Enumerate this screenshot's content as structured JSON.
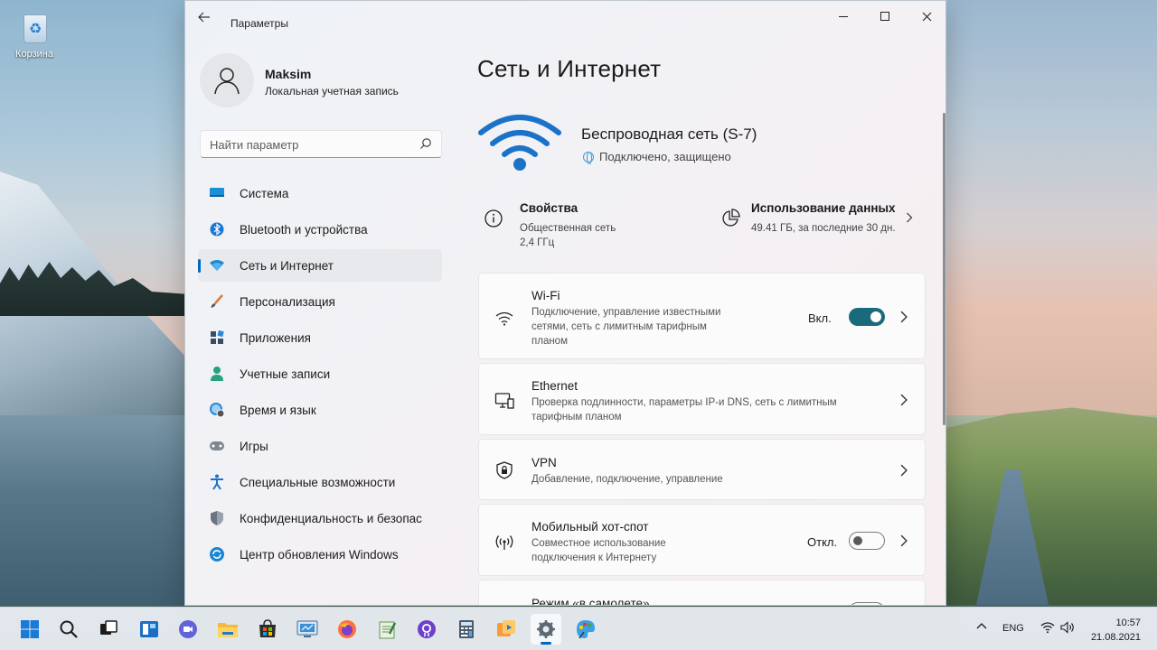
{
  "desktop": {
    "recycle_bin_label": "Корзина"
  },
  "window": {
    "title": "Параметры"
  },
  "profile": {
    "name": "Maksim",
    "account_type": "Локальная учетная запись"
  },
  "search": {
    "placeholder": "Найти параметр"
  },
  "sidebar": {
    "items": [
      {
        "label": "Система",
        "icon": "system-icon",
        "active": false
      },
      {
        "label": "Bluetooth и устройства",
        "icon": "bluetooth-icon",
        "active": false
      },
      {
        "label": "Сеть и Интернет",
        "icon": "network-icon",
        "active": true
      },
      {
        "label": "Персонализация",
        "icon": "brush-icon",
        "active": false
      },
      {
        "label": "Приложения",
        "icon": "apps-icon",
        "active": false
      },
      {
        "label": "Учетные записи",
        "icon": "accounts-icon",
        "active": false
      },
      {
        "label": "Время и язык",
        "icon": "time-language-icon",
        "active": false
      },
      {
        "label": "Игры",
        "icon": "gaming-icon",
        "active": false
      },
      {
        "label": "Специальные возможности",
        "icon": "accessibility-icon",
        "active": false
      },
      {
        "label": "Конфиденциальность и безопас",
        "icon": "shield-icon",
        "active": false
      },
      {
        "label": "Центр обновления Windows",
        "icon": "update-icon",
        "active": false
      }
    ]
  },
  "main": {
    "title": "Сеть и Интернет",
    "connection": {
      "name": "Беспроводная сеть (S-7)",
      "status": "Подключено, защищено"
    },
    "properties": {
      "title": "Свойства",
      "line1": "Общественная сеть",
      "line2": "2,4 ГГц"
    },
    "data_usage": {
      "title": "Использование данных",
      "subtitle": "49.41 ГБ, за последние 30 дн."
    },
    "cards": {
      "wifi": {
        "title": "Wi-Fi",
        "desc": "Подключение, управление известными сетями, сеть с лимитным тарифным планом",
        "toggle_label": "Вкл.",
        "toggle_on": true
      },
      "ethernet": {
        "title": "Ethernet",
        "desc": "Проверка подлинности, параметры IP-и DNS, сеть с лимитным тарифным планом"
      },
      "vpn": {
        "title": "VPN",
        "desc": "Добавление, подключение, управление"
      },
      "hotspot": {
        "title": "Мобильный хот-спот",
        "desc": "Совместное использование подключения к Интернету",
        "toggle_label": "Откл.",
        "toggle_on": false
      },
      "airplane": {
        "title": "Режим «в самолете»"
      }
    }
  },
  "taskbar": {
    "apps": [
      "start-icon",
      "search-icon",
      "task-view-icon",
      "widgets-icon",
      "chat-icon",
      "file-explorer-icon",
      "store-icon",
      "control-panel-icon",
      "firefox-icon",
      "notepad-icon",
      "github-icon",
      "calculator-icon",
      "media-player-icon",
      "settings-icon",
      "paint-icon"
    ],
    "lang": "ENG",
    "time": "10:57",
    "date": "21.08.2021"
  },
  "colors": {
    "accent": "#0067c0",
    "toggle_on": "#1b6a7b",
    "wifi_blue": "#1a73c7"
  }
}
